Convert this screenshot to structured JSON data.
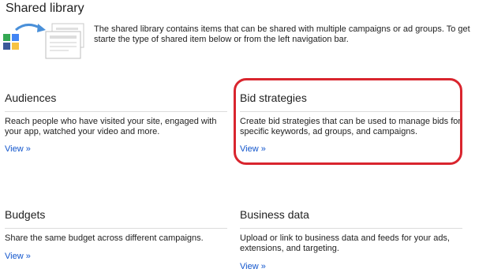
{
  "header": {
    "title": "Shared library",
    "intro": "The shared library contains items that can be shared with multiple campaigns or ad groups. To get starte the type of shared item below or from the left navigation bar.",
    "illustration_icon": "shared-library-illustration-icon"
  },
  "cards": {
    "audiences": {
      "title": "Audiences",
      "description": "Reach people who have visited your site, engaged with your app, watched your video and more.",
      "link": "View »"
    },
    "bid_strategies": {
      "title": "Bid strategies",
      "description": "Create bid strategies that can be used to manage bids for specific keywords, ad groups, and campaigns.",
      "link": "View »",
      "highlight_color": "#d9252e"
    },
    "budgets": {
      "title": "Budgets",
      "description": "Share the same budget across different campaigns.",
      "link": "View »"
    },
    "business_data": {
      "title": "Business data",
      "description": "Upload or link to business data and feeds for your ads, extensions, and targeting.",
      "link": "View »"
    }
  },
  "colors": {
    "link": "#1155cc",
    "text": "#222222",
    "divider": "#dcdcdc"
  }
}
